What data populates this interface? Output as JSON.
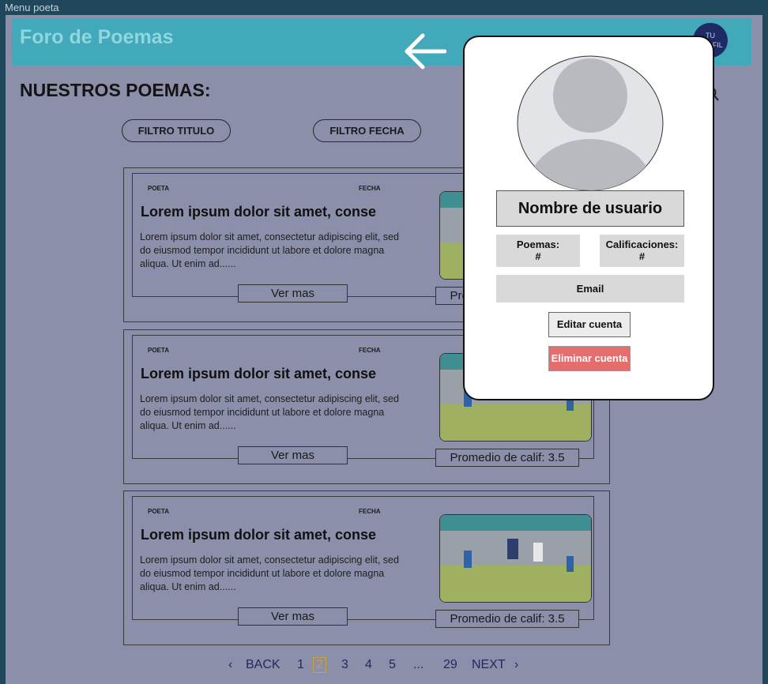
{
  "frame_label": "Menu poeta",
  "header": {
    "brand": "Foro de Poemas",
    "avatar_l1": "TU",
    "avatar_l2": "PERFIL"
  },
  "page_title": "NUESTROS POEMAS:",
  "filters": [
    "FILTRO TITULO",
    "FILTRO FECHA"
  ],
  "cards": [
    {
      "poet_label": "POETA",
      "date_label": "FECHA",
      "title": "Lorem ipsum dolor sit amet, conse",
      "body": "Lorem ipsum dolor sit amet, consectetur adipiscing elit, sed do eiusmod tempor incididunt ut labore et dolore magna aliqua. Ut enim ad......",
      "more": "Ver mas",
      "rating": "Promedio de calif: 3.5"
    },
    {
      "poet_label": "POETA",
      "date_label": "FECHA",
      "title": "Lorem ipsum dolor sit amet, conse",
      "body": "Lorem ipsum dolor sit amet, consectetur adipiscing elit, sed do eiusmod tempor incididunt ut labore et dolore magna aliqua. Ut enim ad......",
      "more": "Ver mas",
      "rating": "Promedio de calif: 3.5"
    },
    {
      "poet_label": "POETA",
      "date_label": "FECHA",
      "title": "Lorem ipsum dolor sit amet, conse",
      "body": "Lorem ipsum dolor sit amet, consectetur adipiscing elit, sed do eiusmod tempor incididunt ut labore et dolore magna aliqua. Ut enim ad......",
      "more": "Ver mas",
      "rating": "Promedio de calif: 3.5"
    }
  ],
  "pagination": {
    "prev": "‹",
    "back": "BACK",
    "pages": [
      "1",
      "2",
      "3",
      "4",
      "5",
      "...",
      "29"
    ],
    "next": "NEXT",
    "next_icon": "›",
    "current": "2"
  },
  "profile": {
    "username": "Nombre de usuario",
    "poems_label": "Poemas:",
    "poems_value": "#",
    "ratings_label": "Calificaciones:",
    "ratings_value": "#",
    "email": "Email",
    "edit": "Editar cuenta",
    "delete": "Eliminar cuenta"
  },
  "colors": {
    "header": "#41a9b9",
    "overlay": "#8b8fa9",
    "delete": "#e46d6d",
    "active_page": "#c9a43a"
  }
}
